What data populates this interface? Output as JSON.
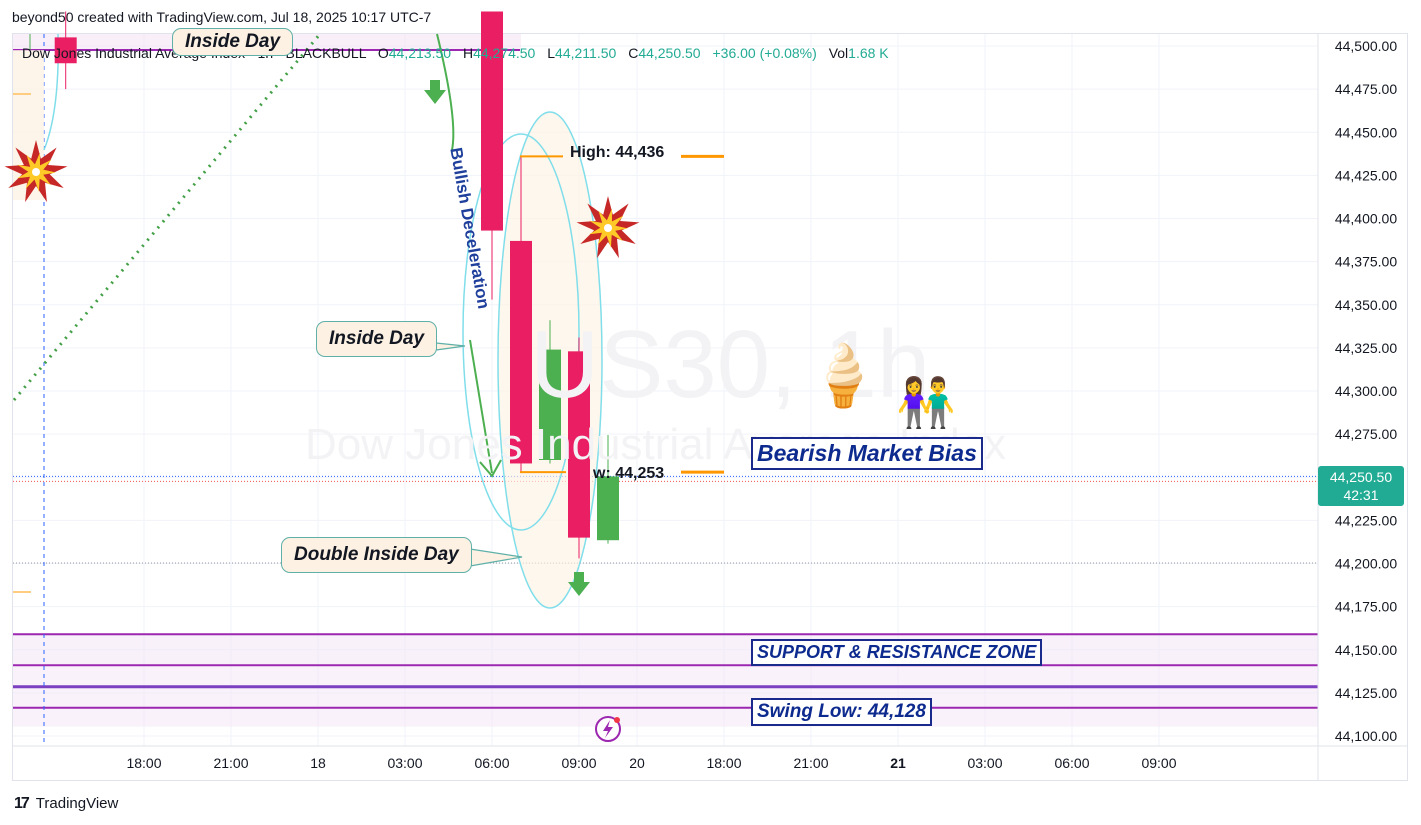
{
  "header": {
    "credit": "beyond50 created with TradingView.com, Jul 18, 2025 10:17 UTC-7"
  },
  "legend": {
    "symbol": "Dow Jones Industrial Average Index · 1h · BLACKBULL",
    "o_label": "O",
    "o_value": "44,213.50",
    "h_label": "H",
    "h_value": "44,274.50",
    "l_label": "L",
    "l_value": "44,211.50",
    "c_label": "C",
    "c_value": "44,250.50",
    "change": "+36.00 (+0.08%)",
    "vol_label": "Vol",
    "vol_value": "1.68 K"
  },
  "watermark": {
    "symbol": "US30, 1h",
    "description": "Dow Jones Industrial Average Index"
  },
  "annotations": {
    "inside_day_top": "Inside Day",
    "inside_day": "Inside Day",
    "double_inside_day": "Double Inside Day",
    "bullish_deceleration": "Bullish Deceleration",
    "high_label": "High: 44,436",
    "low_label": "w: 44,253",
    "bearish_bias": "Bearish Market Bias",
    "sr_zone": "SUPPORT & RESISTANCE ZONE",
    "swing_low": "Swing Low: 44,128"
  },
  "price_tag": {
    "price": "44,250.50",
    "countdown": "42:31"
  },
  "footer": {
    "brand": "TradingView",
    "logo_text": "17"
  },
  "colors": {
    "up": "#4caf50",
    "down": "#e91e63",
    "zone": "#9c27b0",
    "level": "#ff9800",
    "accent": "#22ab94"
  },
  "chart_data": {
    "type": "candlestick",
    "ylim": [
      44087.5,
      44512.5
    ],
    "y_ticks": [
      44100,
      44125,
      44150,
      44175,
      44200,
      44225,
      44250,
      44275,
      44300,
      44325,
      44350,
      44375,
      44400,
      44425,
      44450,
      44475,
      44500
    ],
    "y_tick_labels": [
      "44,100.00",
      "44,125.00",
      "44,150.00",
      "44,175.00",
      "44,200.00",
      "44,225.00",
      "44,250.00",
      "44,275.00",
      "44,300.00",
      "44,325.00",
      "44,350.00",
      "44,375.00",
      "44,400.00",
      "44,425.00",
      "44,450.00",
      "44,475.00",
      "44,500.00"
    ],
    "x_ticks": [
      "18:00",
      "21:00",
      "18",
      "03:00",
      "06:00",
      "09:00",
      "20",
      "18:00",
      "21:00",
      "21",
      "03:00",
      "06:00",
      "09:00"
    ],
    "x_tick_index": [
      -12,
      -9,
      -6,
      -3,
      0,
      3,
      5,
      8,
      11,
      14,
      17,
      20,
      23
    ],
    "candles": [
      {
        "i": -14.7,
        "open": 44505,
        "high": 44520,
        "low": 44475,
        "close": 44490
      },
      {
        "i": 0,
        "open": 44520,
        "high": 44520,
        "low": 44353,
        "close": 44393
      },
      {
        "i": 1,
        "open": 44387,
        "high": 44436,
        "low": 44253,
        "close": 44258
      },
      {
        "i": 2,
        "open": 44260,
        "high": 44341,
        "low": 44258,
        "close": 44324
      },
      {
        "i": 3,
        "open": 44323,
        "high": 44331,
        "low": 44203,
        "close": 44215
      },
      {
        "i": 4,
        "open": 44213.5,
        "high": 44274.5,
        "low": 44211.5,
        "close": 44250.5
      }
    ],
    "levels": [
      {
        "name": "High",
        "value": 44436
      },
      {
        "name": "Low",
        "value": 44253
      },
      {
        "name": "Swing Low",
        "value": 44128
      }
    ],
    "zones": [
      {
        "name": "SUPPORT & RESISTANCE ZONE",
        "from": 44141,
        "to": 44159
      }
    ],
    "current_price": 44250.5
  }
}
